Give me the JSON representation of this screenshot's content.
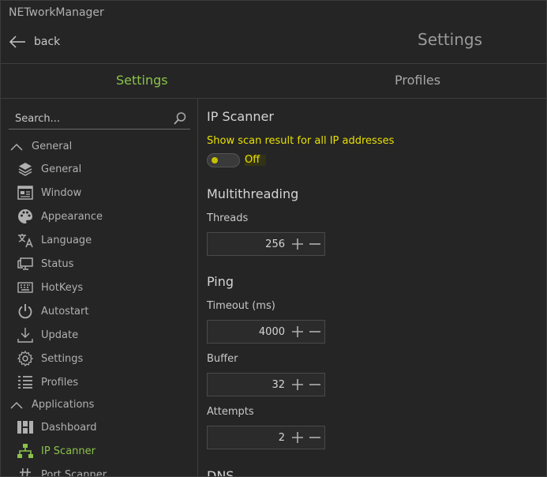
{
  "app": {
    "title": "NETworkManager"
  },
  "header": {
    "back_label": "back",
    "page_title": "Settings"
  },
  "tabs": [
    {
      "label": "Settings",
      "active": true
    },
    {
      "label": "Profiles",
      "active": false
    }
  ],
  "sidebar": {
    "search_placeholder": "Search...",
    "groups": [
      {
        "label": "General",
        "items": [
          {
            "label": "General",
            "icon": "layers-icon"
          },
          {
            "label": "Window",
            "icon": "window-icon"
          },
          {
            "label": "Appearance",
            "icon": "palette-icon"
          },
          {
            "label": "Language",
            "icon": "translate-icon"
          },
          {
            "label": "Status",
            "icon": "monitor-icon"
          },
          {
            "label": "HotKeys",
            "icon": "keyboard-icon"
          },
          {
            "label": "Autostart",
            "icon": "power-icon"
          },
          {
            "label": "Update",
            "icon": "download-icon"
          },
          {
            "label": "Settings",
            "icon": "gear-icon"
          },
          {
            "label": "Profiles",
            "icon": "list-icon"
          }
        ]
      },
      {
        "label": "Applications",
        "items": [
          {
            "label": "Dashboard",
            "icon": "dashboard-icon"
          },
          {
            "label": "IP Scanner",
            "icon": "network-icon",
            "selected": true
          },
          {
            "label": "Port Scanner",
            "icon": "hash-icon"
          }
        ]
      }
    ]
  },
  "content": {
    "ip_scanner": {
      "title": "IP Scanner",
      "show_all_label": "Show scan result for all IP addresses",
      "show_all_state": "Off"
    },
    "multithreading": {
      "title": "Multithreading",
      "threads_label": "Threads",
      "threads_value": "256"
    },
    "ping": {
      "title": "Ping",
      "timeout_label": "Timeout (ms)",
      "timeout_value": "4000",
      "buffer_label": "Buffer",
      "buffer_value": "32",
      "attempts_label": "Attempts",
      "attempts_value": "2"
    },
    "dns": {
      "title": "DNS"
    }
  },
  "colors": {
    "accent": "#8bc34a",
    "warning": "#e8e000",
    "background": "#252526"
  }
}
